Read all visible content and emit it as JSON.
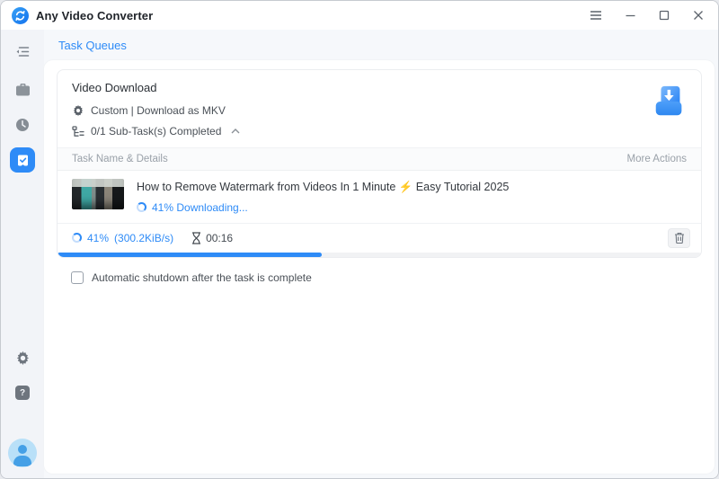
{
  "window": {
    "title": "Any Video Converter",
    "controls": {
      "menu_icon": "hamburger-menu",
      "minimize_icon": "minimize",
      "maximize_icon": "maximize",
      "close_icon": "close"
    }
  },
  "sidebar": {
    "icons": [
      "collapse-sidebar",
      "toolbox",
      "history-clock",
      "task-queues-active",
      "settings-gear",
      "help-question",
      "user-avatar"
    ]
  },
  "tabs": {
    "active": "Task Queues"
  },
  "task_group": {
    "title": "Video Download",
    "profile": "Custom | Download as MKV",
    "subtask_summary": "0/1 Sub-Task(s) Completed",
    "table": {
      "header_left": "Task Name & Details",
      "header_right": "More Actions"
    },
    "task": {
      "name": "How to Remove Watermark from Videos In 1 Minute ⚡ Easy Tutorial 2025",
      "status": "41% Downloading...",
      "percent_label": "41%",
      "speed": "(300.2KiB/s)",
      "time": "00:16",
      "progress_percent": 41
    }
  },
  "footer": {
    "shutdown_label": "Automatic shutdown after the task is complete"
  },
  "colors": {
    "accent": "#2e8bf7",
    "sidebar_bg": "#f2f4f8",
    "panel_bg": "#ffffff"
  }
}
